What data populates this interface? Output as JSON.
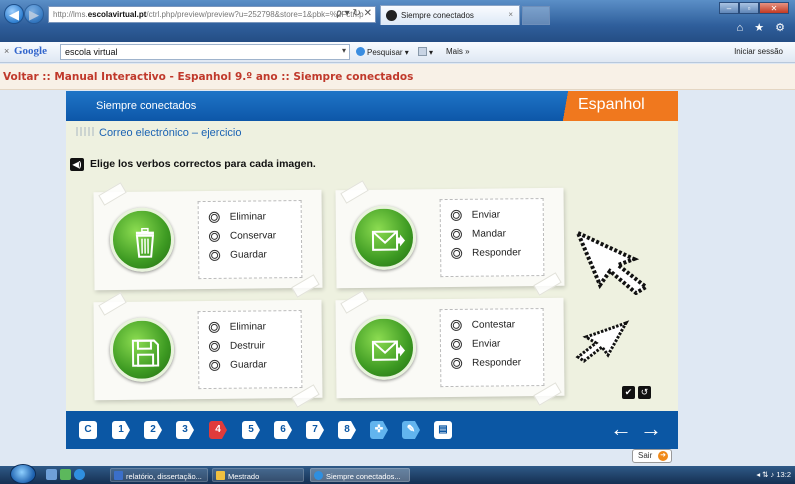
{
  "browser": {
    "url_prefix": "http://lms.",
    "url_domain": "escolavirtual.pt",
    "url_rest": "/ctrl.php/preview/preview?u=252798&store=1&pbk=%2Fctrl.p",
    "address_tools": "ρ ▾ ↻ ✕",
    "tab_title": "Siempre conectados",
    "tab_close": "×",
    "window_controls": [
      "–",
      "▫",
      "✕"
    ],
    "top_icons": "⌂ ★ ⚙"
  },
  "google_toolbar": {
    "close": "×",
    "logo": "Google",
    "search_value": "escola virtual",
    "search_button": "Pesquisar",
    "more": "Mais »",
    "login": "Iniciar sessão"
  },
  "breadcrumb": "Voltar :: Manual Interactivo - Espanhol 9.º ano :: Siempre conectados",
  "activity": {
    "header_title": "Siempre conectados",
    "brand": "Espanhol",
    "subtitle": "Correo electrónico – ejercicio",
    "instruction": "Elige los verbos correctos para cada imagen.",
    "cards": [
      {
        "icon": "trash-icon",
        "options": [
          "Eliminar",
          "Conservar",
          "Guardar"
        ]
      },
      {
        "icon": "send-mail-icon",
        "options": [
          "Enviar",
          "Mandar",
          "Responder"
        ]
      },
      {
        "icon": "save-disk-icon",
        "options": [
          "Eliminar",
          "Destruir",
          "Guardar"
        ]
      },
      {
        "icon": "reply-mail-icon",
        "options": [
          "Contestar",
          "Enviar",
          "Responder"
        ]
      }
    ],
    "check_buttons": [
      "✔",
      "↺"
    ]
  },
  "pagination": {
    "first": "C",
    "pages": [
      "1",
      "2",
      "3",
      "4",
      "5",
      "6",
      "7",
      "8"
    ],
    "current": "4",
    "prev_arrow": "←",
    "next_arrow": "→"
  },
  "exit_label": "Sair",
  "taskbar": {
    "items": [
      "relatório, dissertação...",
      "Mestrado",
      "Siempre conectados..."
    ],
    "clock": "13:2"
  },
  "colors": {
    "header_blue": "#0d57a8",
    "brand_orange": "#f0781e",
    "icon_green": "#3d9a22",
    "current_page_red": "#e03b3b",
    "breadcrumb_red": "#c0392b"
  }
}
